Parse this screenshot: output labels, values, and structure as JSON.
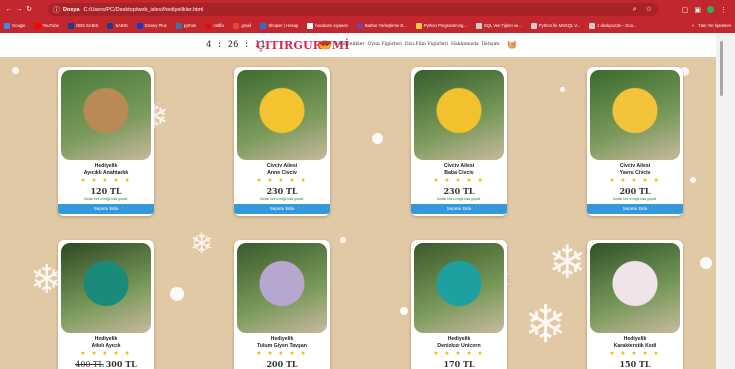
{
  "browser": {
    "url_site": "Dosya",
    "url_path": "C:/Users/PC/Desktop/web_islevi/hediyelikler.html",
    "bookmarks": [
      {
        "label": "Google",
        "color": "#4285f4"
      },
      {
        "label": "YouTube",
        "color": "#ff0000"
      },
      {
        "label": "OBS SABIS",
        "color": "#1a3d8f"
      },
      {
        "label": "SABIS",
        "color": "#1a3d8f"
      },
      {
        "label": "Disney Plus",
        "color": "#113ccf"
      },
      {
        "label": "python",
        "color": "#3776ab"
      },
      {
        "label": "netflix",
        "color": "#e50914"
      },
      {
        "label": "gmail",
        "color": "#ea4335"
      },
      {
        "label": "Shopier | Hesap",
        "color": "#2d6cdf"
      },
      {
        "label": "hocaların siyasetı",
        "color": "#ffffff"
      },
      {
        "label": "Barber Yerleştirme B...",
        "color": "#7b3fa0"
      },
      {
        "label": "Python Programmıng...",
        "color": "#f7c744"
      },
      {
        "label": "SQL Veri Tipleri ve...",
        "color": "#cccccc"
      },
      {
        "label": "Python İle MSSQL V...",
        "color": "#cccccc"
      },
      {
        "label": "z deskpuzzle - Goo...",
        "color": "#cccccc"
      }
    ],
    "bookmarks_overflow": "»",
    "all_bookmarks": "Tüm Yer İşaretleri"
  },
  "header": {
    "clock": "4 : 26 : 11",
    "logo": "ÇITIRGURUMİ",
    "nav": [
      "Hediyelikler",
      "Oyun Figürleri",
      "Dizi-Film Figürleri",
      "Hakkımızda",
      "İletişim"
    ],
    "basket_icon": "basket-icon"
  },
  "products": [
    {
      "name1": "Hediyelik",
      "name2": "Ayıcıklı Anahtarlık",
      "stars": "★ ★ ★ ★ ★",
      "price": "120 TL",
      "old_price": "",
      "ship": "Kartlar kırıl in bağlı kala güçakl.",
      "button": "Sepete Ekle"
    },
    {
      "name1": "Civciv Ailesi",
      "name2": "Anne Civciv",
      "stars": "★ ★ ★ ★ ★",
      "price": "230 TL",
      "old_price": "",
      "ship": "Kartlar kırıl in bağlı kala güçakl.",
      "button": "Sepete Ekle"
    },
    {
      "name1": "Civciv Ailesi",
      "name2": "Baba Civciv",
      "stars": "★ ★ ★ ★ ★",
      "price": "230 TL",
      "old_price": "",
      "ship": "Kartlar kırıl in bağlı kala güçakl.",
      "button": "Sepete Ekle"
    },
    {
      "name1": "Civciv Ailesi",
      "name2": "Yavru Civciv",
      "stars": "★ ★ ★ ★ ★",
      "price": "200 TL",
      "old_price": "",
      "ship": "Kartlar kırıl in bağlı kala güçakl.",
      "button": "Sepete Ekle"
    },
    {
      "name1": "Hediyelik",
      "name2": "Atkılı Ayıcık",
      "stars": "★ ★ ★ ★ ★",
      "price": "300 TL",
      "old_price": "400 TL",
      "ship": "",
      "button": ""
    },
    {
      "name1": "Hediyelik",
      "name2": "Tulum Giyen Tavşan",
      "stars": "★ ★ ★ ★ ★",
      "price": "200 TL",
      "old_price": "",
      "ship": "",
      "button": ""
    },
    {
      "name1": "Hediyelik",
      "name2": "Denizkızı Unicorn",
      "stars": "★ ★ ★ ★ ★",
      "price": "170 TL",
      "old_price": "",
      "ship": "",
      "button": ""
    },
    {
      "name1": "Hediyelik",
      "name2": "Karakterstik Kedi",
      "stars": "★ ★ ★ ★ ★",
      "price": "150 TL",
      "old_price": "",
      "ship": "",
      "button": ""
    }
  ],
  "colors": {
    "browser_bar": "#c1272d",
    "page_bg": "#e2c9a5",
    "logo": "#d8294f",
    "button": "#3498db",
    "stars": "#f2b705"
  }
}
